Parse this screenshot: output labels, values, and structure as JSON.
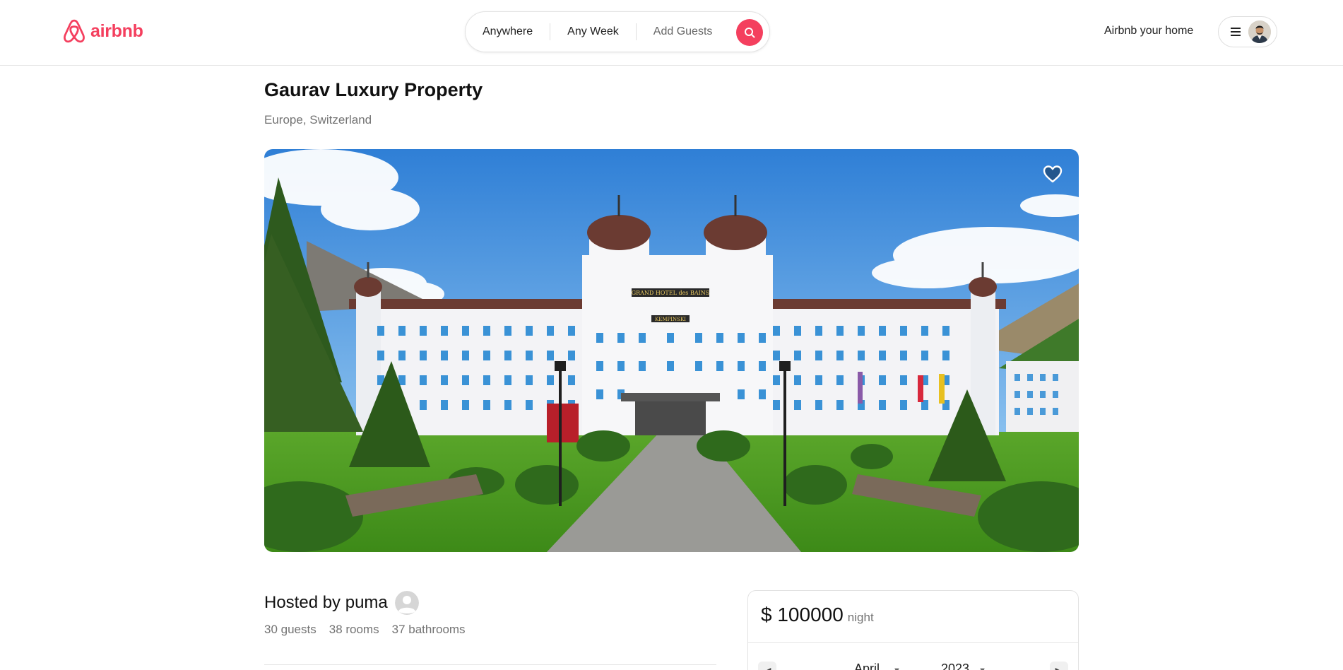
{
  "header": {
    "brand": "airbnb",
    "search": {
      "where_label": "Anywhere",
      "when_label": "Any Week",
      "guests_label": "Add Guests"
    },
    "host_link": "Airbnb your home"
  },
  "listing": {
    "title": "Gaurav Luxury Property",
    "location": "Europe, Switzerland",
    "photo_sign_1": "GRAND HOTEL des BAINS",
    "photo_sign_2": "KEMPINSKI",
    "host_text": "Hosted by puma",
    "guests": "30 guests",
    "rooms": "38 rooms",
    "bathrooms": "37 bathrooms"
  },
  "reservation": {
    "price": "$ 100000",
    "unit": "night",
    "month": "April",
    "year": "2023"
  },
  "colors": {
    "brand": "#f43f5e",
    "muted_text": "#737373"
  }
}
